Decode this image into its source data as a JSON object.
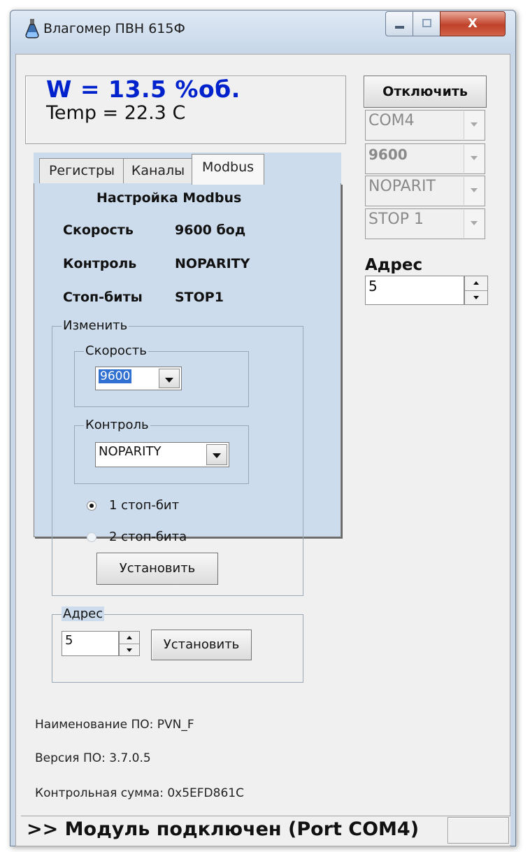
{
  "window": {
    "title": "Влагомер ПВН 615Ф",
    "close_glyph": "X",
    "icons": [
      "flask-icon",
      "minimize-icon",
      "maximize-icon",
      "close-icon"
    ]
  },
  "readout": {
    "moisture": "W =  13.5 %об.",
    "temperature": "Temp = 22.3 C",
    "moisture_color": "#0022cc"
  },
  "connection": {
    "disconnect_label": "Отключить",
    "port": "COM4",
    "baud": "9600",
    "parity": "NOPARIT",
    "stop": "STOP 1",
    "address_label": "Адрес",
    "address_value": "5"
  },
  "tabs": [
    {
      "label": "Регистры",
      "active": false
    },
    {
      "label": "Каналы",
      "active": false
    },
    {
      "label": "Modbus",
      "active": true
    }
  ],
  "modbus": {
    "heading": "Настройка Modbus",
    "rows": [
      {
        "label": "Скорость",
        "value": "9600 бод"
      },
      {
        "label": "Контроль",
        "value": "NOPARITY"
      },
      {
        "label": "Стоп-биты",
        "value": "STOP1"
      }
    ],
    "change_group": "Изменить",
    "speed_group": "Скорость",
    "speed_value": "9600",
    "parity_group": "Контроль",
    "parity_value": "NOPARITY",
    "stop_options": [
      "1 стоп-бит",
      "2 стоп-бита"
    ],
    "stop_selected_index": 0,
    "set_label": "Установить",
    "address_group": "Адрес",
    "address_value": "5",
    "address_set_label": "Установить"
  },
  "software": {
    "name": "Наименование ПО: PVN_F",
    "version": "Версия ПО: 3.7.0.5",
    "checksum": "Контрольная сумма: 0x5EFD861C"
  },
  "status": {
    "message": ">> Модуль подключен (Port COM4)"
  }
}
